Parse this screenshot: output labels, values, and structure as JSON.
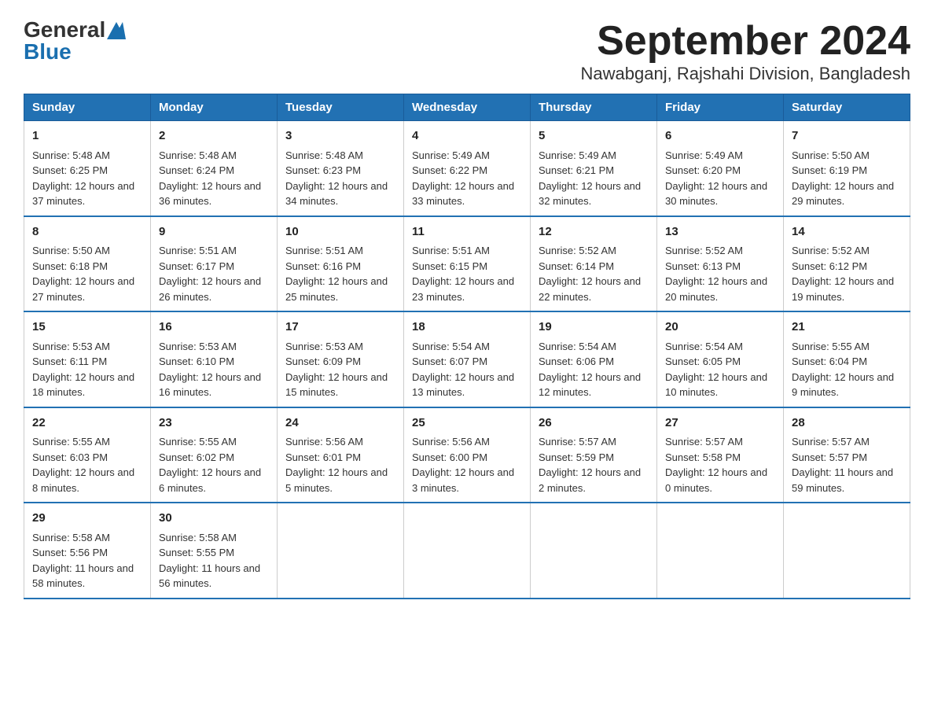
{
  "logo": {
    "general": "General",
    "blue": "Blue"
  },
  "title": "September 2024",
  "subtitle": "Nawabganj, Rajshahi Division, Bangladesh",
  "days": [
    "Sunday",
    "Monday",
    "Tuesday",
    "Wednesday",
    "Thursday",
    "Friday",
    "Saturday"
  ],
  "weeks": [
    [
      {
        "day": "1",
        "sunrise": "Sunrise: 5:48 AM",
        "sunset": "Sunset: 6:25 PM",
        "daylight": "Daylight: 12 hours and 37 minutes."
      },
      {
        "day": "2",
        "sunrise": "Sunrise: 5:48 AM",
        "sunset": "Sunset: 6:24 PM",
        "daylight": "Daylight: 12 hours and 36 minutes."
      },
      {
        "day": "3",
        "sunrise": "Sunrise: 5:48 AM",
        "sunset": "Sunset: 6:23 PM",
        "daylight": "Daylight: 12 hours and 34 minutes."
      },
      {
        "day": "4",
        "sunrise": "Sunrise: 5:49 AM",
        "sunset": "Sunset: 6:22 PM",
        "daylight": "Daylight: 12 hours and 33 minutes."
      },
      {
        "day": "5",
        "sunrise": "Sunrise: 5:49 AM",
        "sunset": "Sunset: 6:21 PM",
        "daylight": "Daylight: 12 hours and 32 minutes."
      },
      {
        "day": "6",
        "sunrise": "Sunrise: 5:49 AM",
        "sunset": "Sunset: 6:20 PM",
        "daylight": "Daylight: 12 hours and 30 minutes."
      },
      {
        "day": "7",
        "sunrise": "Sunrise: 5:50 AM",
        "sunset": "Sunset: 6:19 PM",
        "daylight": "Daylight: 12 hours and 29 minutes."
      }
    ],
    [
      {
        "day": "8",
        "sunrise": "Sunrise: 5:50 AM",
        "sunset": "Sunset: 6:18 PM",
        "daylight": "Daylight: 12 hours and 27 minutes."
      },
      {
        "day": "9",
        "sunrise": "Sunrise: 5:51 AM",
        "sunset": "Sunset: 6:17 PM",
        "daylight": "Daylight: 12 hours and 26 minutes."
      },
      {
        "day": "10",
        "sunrise": "Sunrise: 5:51 AM",
        "sunset": "Sunset: 6:16 PM",
        "daylight": "Daylight: 12 hours and 25 minutes."
      },
      {
        "day": "11",
        "sunrise": "Sunrise: 5:51 AM",
        "sunset": "Sunset: 6:15 PM",
        "daylight": "Daylight: 12 hours and 23 minutes."
      },
      {
        "day": "12",
        "sunrise": "Sunrise: 5:52 AM",
        "sunset": "Sunset: 6:14 PM",
        "daylight": "Daylight: 12 hours and 22 minutes."
      },
      {
        "day": "13",
        "sunrise": "Sunrise: 5:52 AM",
        "sunset": "Sunset: 6:13 PM",
        "daylight": "Daylight: 12 hours and 20 minutes."
      },
      {
        "day": "14",
        "sunrise": "Sunrise: 5:52 AM",
        "sunset": "Sunset: 6:12 PM",
        "daylight": "Daylight: 12 hours and 19 minutes."
      }
    ],
    [
      {
        "day": "15",
        "sunrise": "Sunrise: 5:53 AM",
        "sunset": "Sunset: 6:11 PM",
        "daylight": "Daylight: 12 hours and 18 minutes."
      },
      {
        "day": "16",
        "sunrise": "Sunrise: 5:53 AM",
        "sunset": "Sunset: 6:10 PM",
        "daylight": "Daylight: 12 hours and 16 minutes."
      },
      {
        "day": "17",
        "sunrise": "Sunrise: 5:53 AM",
        "sunset": "Sunset: 6:09 PM",
        "daylight": "Daylight: 12 hours and 15 minutes."
      },
      {
        "day": "18",
        "sunrise": "Sunrise: 5:54 AM",
        "sunset": "Sunset: 6:07 PM",
        "daylight": "Daylight: 12 hours and 13 minutes."
      },
      {
        "day": "19",
        "sunrise": "Sunrise: 5:54 AM",
        "sunset": "Sunset: 6:06 PM",
        "daylight": "Daylight: 12 hours and 12 minutes."
      },
      {
        "day": "20",
        "sunrise": "Sunrise: 5:54 AM",
        "sunset": "Sunset: 6:05 PM",
        "daylight": "Daylight: 12 hours and 10 minutes."
      },
      {
        "day": "21",
        "sunrise": "Sunrise: 5:55 AM",
        "sunset": "Sunset: 6:04 PM",
        "daylight": "Daylight: 12 hours and 9 minutes."
      }
    ],
    [
      {
        "day": "22",
        "sunrise": "Sunrise: 5:55 AM",
        "sunset": "Sunset: 6:03 PM",
        "daylight": "Daylight: 12 hours and 8 minutes."
      },
      {
        "day": "23",
        "sunrise": "Sunrise: 5:55 AM",
        "sunset": "Sunset: 6:02 PM",
        "daylight": "Daylight: 12 hours and 6 minutes."
      },
      {
        "day": "24",
        "sunrise": "Sunrise: 5:56 AM",
        "sunset": "Sunset: 6:01 PM",
        "daylight": "Daylight: 12 hours and 5 minutes."
      },
      {
        "day": "25",
        "sunrise": "Sunrise: 5:56 AM",
        "sunset": "Sunset: 6:00 PM",
        "daylight": "Daylight: 12 hours and 3 minutes."
      },
      {
        "day": "26",
        "sunrise": "Sunrise: 5:57 AM",
        "sunset": "Sunset: 5:59 PM",
        "daylight": "Daylight: 12 hours and 2 minutes."
      },
      {
        "day": "27",
        "sunrise": "Sunrise: 5:57 AM",
        "sunset": "Sunset: 5:58 PM",
        "daylight": "Daylight: 12 hours and 0 minutes."
      },
      {
        "day": "28",
        "sunrise": "Sunrise: 5:57 AM",
        "sunset": "Sunset: 5:57 PM",
        "daylight": "Daylight: 11 hours and 59 minutes."
      }
    ],
    [
      {
        "day": "29",
        "sunrise": "Sunrise: 5:58 AM",
        "sunset": "Sunset: 5:56 PM",
        "daylight": "Daylight: 11 hours and 58 minutes."
      },
      {
        "day": "30",
        "sunrise": "Sunrise: 5:58 AM",
        "sunset": "Sunset: 5:55 PM",
        "daylight": "Daylight: 11 hours and 56 minutes."
      },
      null,
      null,
      null,
      null,
      null
    ]
  ]
}
